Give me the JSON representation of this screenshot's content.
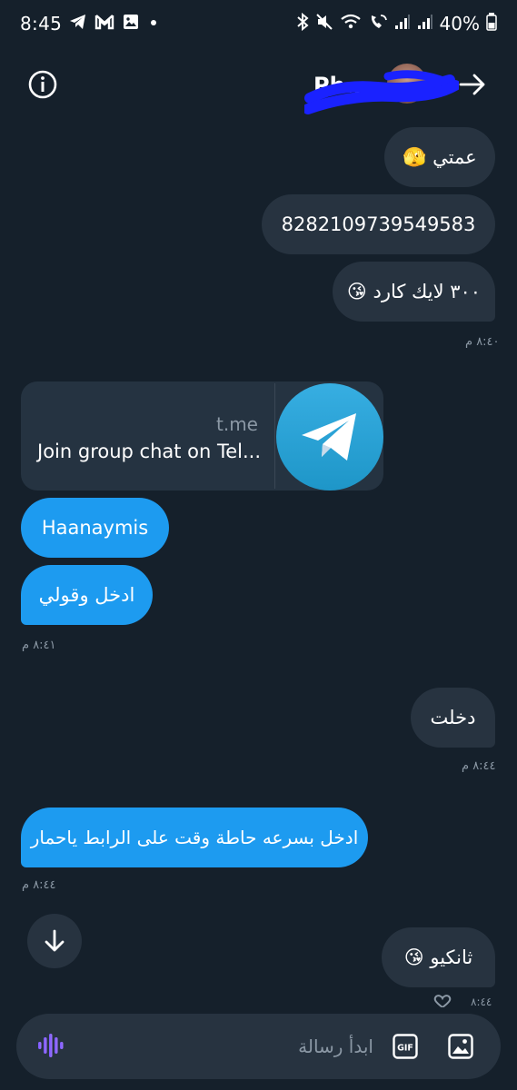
{
  "status_bar": {
    "time": "8:45",
    "battery": "40%"
  },
  "header": {
    "contact_name": "Ph.."
  },
  "messages": [
    {
      "text": "عمتي 🫣",
      "side": "received"
    },
    {
      "text": "8282109739549583",
      "side": "received"
    },
    {
      "text": "٣٠٠ لايك كارد 😘",
      "side": "received"
    },
    {
      "timestamp": "٨:٤٠ م"
    },
    {
      "link_card": {
        "domain": "t.me",
        "title": "Join group chat on Tel..."
      },
      "side": "sent"
    },
    {
      "text": "Haanaymis",
      "side": "sent"
    },
    {
      "text": "ادخل وقولي",
      "side": "sent"
    },
    {
      "timestamp": "٨:٤١ م"
    },
    {
      "text": "دخلت",
      "side": "received"
    },
    {
      "timestamp": "٨:٤٤ م"
    },
    {
      "text": "ادخل بسرعه حاطة وقت على الرابط ياحمار",
      "side": "sent"
    },
    {
      "timestamp": "٨:٤٤ م"
    },
    {
      "text": "ثانكيو 😘",
      "side": "received"
    },
    {
      "timestamp": "٨:٤٤"
    }
  ],
  "composer": {
    "placeholder": "ابدأ رسالة",
    "gif_label": "GIF"
  },
  "colors": {
    "background": "#15202b",
    "received_bubble": "#273340",
    "sent_bubble": "#1d9bf0",
    "muted_text": "#8b98a5"
  },
  "icons": [
    "telegram-icon",
    "gmail-icon",
    "gallery-icon",
    "bluetooth-icon",
    "mute-icon",
    "wifi-icon",
    "wifi-call-icon",
    "signal-icon",
    "battery-icon",
    "info-icon",
    "arrow-right-icon",
    "arrow-down-icon",
    "voice-icon",
    "gif-icon",
    "image-icon",
    "heart-icon"
  ]
}
